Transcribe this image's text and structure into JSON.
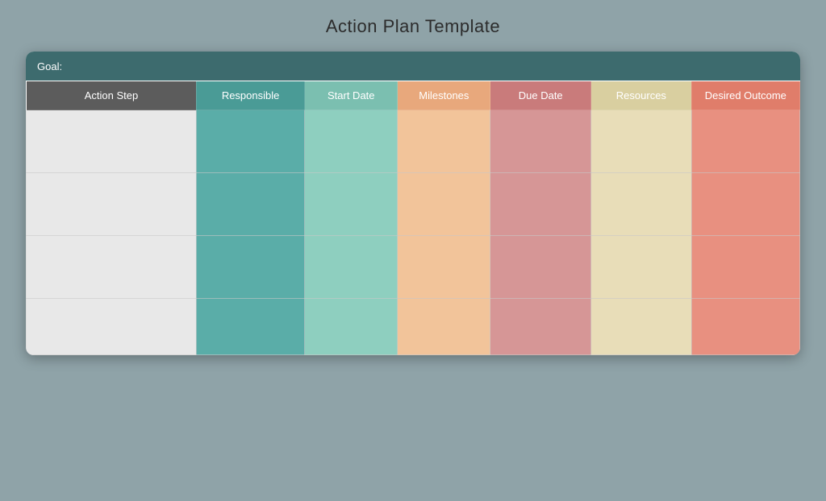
{
  "page": {
    "title": "Action Plan Template",
    "background_color": "#8fa3a8"
  },
  "goal_row": {
    "label": "Goal:"
  },
  "columns": [
    {
      "id": "action-step",
      "label": "Action Step",
      "class_header": "col-action-step",
      "class_cell": "cell-action-step"
    },
    {
      "id": "responsible",
      "label": "Responsible",
      "class_header": "col-responsible",
      "class_cell": "cell-responsible"
    },
    {
      "id": "start-date",
      "label": "Start Date",
      "class_header": "col-start-date",
      "class_cell": "cell-start-date"
    },
    {
      "id": "milestones",
      "label": "Milestones",
      "class_header": "col-milestones",
      "class_cell": "cell-milestones"
    },
    {
      "id": "due-date",
      "label": "Due Date",
      "class_header": "col-due-date",
      "class_cell": "cell-due-date"
    },
    {
      "id": "resources",
      "label": "Resources",
      "class_header": "col-resources",
      "class_cell": "cell-resources"
    },
    {
      "id": "desired",
      "label": "Desired Outcome",
      "class_header": "col-desired",
      "class_cell": "cell-desired"
    }
  ],
  "rows": 4
}
